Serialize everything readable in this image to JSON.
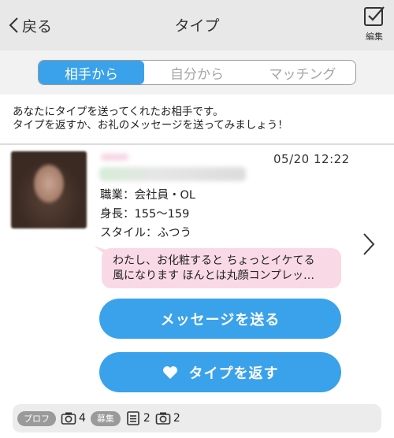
{
  "header": {
    "back_label": "戻る",
    "title": "タイプ",
    "edit_label": "編集"
  },
  "tabs": [
    {
      "label": "相手から",
      "active": true
    },
    {
      "label": "自分から",
      "active": false
    },
    {
      "label": "マッチング",
      "active": false
    }
  ],
  "description": {
    "line1": "あなたにタイプを送ってくれたお相手です。",
    "line2": "タイプを返すか、お礼のメッセージを送ってみましょう！"
  },
  "profile": {
    "datetime": "05/20 12:22",
    "occupation": "職業：会社員・OL",
    "height": "身長：155〜159",
    "style": "スタイル：ふつう",
    "message_line1": "わたし、お化粧すると ちょっとイケてる",
    "message_line2": "風になります ほんとは丸顔コンプレッ…"
  },
  "actions": {
    "message_button": "メッセージを送る",
    "type_back_button": "タイプを返す"
  },
  "footer": {
    "profile_tag": "プロフ",
    "profile_photo_count": "4",
    "recruit_tag": "募集",
    "recruit_post_count": "2",
    "recruit_photo_count": "2"
  },
  "colors": {
    "accent": "#3aa2ea",
    "bubble": "#f9d9e5",
    "header_bg": "#e8e8e8"
  }
}
